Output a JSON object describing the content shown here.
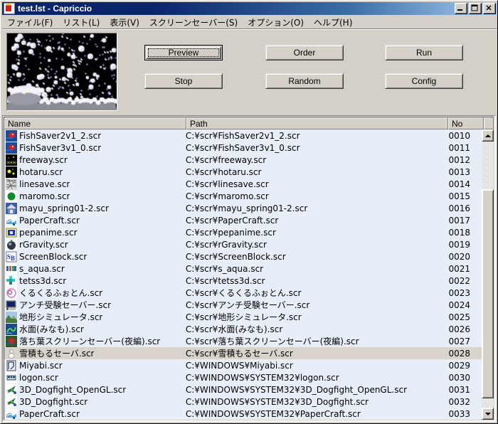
{
  "window": {
    "title": "test.lst - Capriccio",
    "icon": "app-icon",
    "controls": [
      {
        "name": "minimize-button",
        "glyph": "minimize"
      },
      {
        "name": "maximize-button",
        "glyph": "maximize"
      },
      {
        "name": "close-button",
        "glyph": "close"
      }
    ]
  },
  "menubar": {
    "items": [
      {
        "label": "ファイル(F)",
        "accel": "F"
      },
      {
        "label": "リスト(L)",
        "accel": "L"
      },
      {
        "label": "表示(V)",
        "accel": "V"
      },
      {
        "label": "スクリーンセーバー(S)",
        "accel": "S"
      },
      {
        "label": "オプション(O)",
        "accel": "O"
      },
      {
        "label": "ヘルプ(H)",
        "accel": "H"
      }
    ]
  },
  "preview": {
    "name": "screensaver-preview",
    "description": "snow-screensaver-preview",
    "background": "#000000"
  },
  "buttons": [
    {
      "name": "preview-button",
      "label": "Preview",
      "default": true,
      "focused": true
    },
    {
      "name": "order-button",
      "label": "Order",
      "default": false,
      "focused": false
    },
    {
      "name": "run-button",
      "label": "Run",
      "default": false,
      "focused": false
    },
    {
      "name": "stop-button",
      "label": "Stop",
      "default": false,
      "focused": false
    },
    {
      "name": "random-button",
      "label": "Random",
      "default": false,
      "focused": false
    },
    {
      "name": "config-button",
      "label": "Config",
      "default": false,
      "focused": false
    }
  ],
  "list": {
    "columns": [
      {
        "key": "name",
        "label": "Name"
      },
      {
        "key": "path",
        "label": "Path"
      },
      {
        "key": "no",
        "label": "No"
      }
    ],
    "row_background": "#e8eef8",
    "selected_background": "#d8d4cc",
    "rows": [
      {
        "name": "FishSaver2v1_2.scr",
        "path": "C:¥scr¥FishSaver2v1_2.scr",
        "no": "0010",
        "icon": "fish-icon",
        "selected": false
      },
      {
        "name": "FishSaver3v1_0.scr",
        "path": "C:¥scr¥FishSaver3v1_0.scr",
        "no": "0011",
        "icon": "fish-icon",
        "selected": false
      },
      {
        "name": "freeway.scr",
        "path": "C:¥scr¥freeway.scr",
        "no": "0012",
        "icon": "freeway-icon",
        "selected": false
      },
      {
        "name": "hotaru.scr",
        "path": "C:¥scr¥hotaru.scr",
        "no": "0013",
        "icon": "firefly-icon",
        "selected": false
      },
      {
        "name": "linesave.scr",
        "path": "C:¥scr¥linesave.scr",
        "no": "0014",
        "icon": "lines-icon",
        "selected": false
      },
      {
        "name": "maromo.scr",
        "path": "C:¥scr¥maromo.scr",
        "no": "0015",
        "icon": "green-circle-icon",
        "selected": false
      },
      {
        "name": "mayu_spring01-2.scr",
        "path": "C:¥scr¥mayu_spring01-2.scr",
        "no": "0016",
        "icon": "house-icon",
        "selected": false
      },
      {
        "name": "PaperCraft.scr",
        "path": "C:¥scr¥PaperCraft.scr",
        "no": "0017",
        "icon": "papercraft-icon",
        "selected": false
      },
      {
        "name": "pepanime.scr",
        "path": "C:¥scr¥pepanime.scr",
        "no": "0018",
        "icon": "pepanime-icon",
        "selected": false
      },
      {
        "name": "rGravity.scr",
        "path": "C:¥scr¥rGravity.scr",
        "no": "0019",
        "icon": "sphere-icon",
        "selected": false
      },
      {
        "name": "ScreenBlock.scr",
        "path": "C:¥scr¥ScreenBlock.scr",
        "no": "0020",
        "icon": "screenblock-icon",
        "selected": false
      },
      {
        "name": "s_aqua.scr",
        "path": "C:¥scr¥s_aqua.scr",
        "no": "0021",
        "icon": "aqua-icon",
        "selected": false
      },
      {
        "name": "tetss3d.scr",
        "path": "C:¥scr¥tetss3d.scr",
        "no": "0022",
        "icon": "tetris-icon",
        "selected": false
      },
      {
        "name": "くるくるふぉとん.scr",
        "path": "C:¥scr¥くるくるふぉとん.scr",
        "no": "0023",
        "icon": "spiral-icon",
        "selected": false
      },
      {
        "name": "アンチ受験セーバー.scr",
        "path": "C:¥scr¥アンチ受験セーバー.scr",
        "no": "0024",
        "icon": "monitor-icon",
        "selected": false
      },
      {
        "name": "地形シミュレータ.scr",
        "path": "C:¥scr¥地形シミュレータ.scr",
        "no": "0025",
        "icon": "terrain-icon",
        "selected": false
      },
      {
        "name": "水面(みなも).scr",
        "path": "C:¥scr¥水面(みなも).scr",
        "no": "0026",
        "icon": "water-icon",
        "selected": false
      },
      {
        "name": "落ち葉スクリーンセーバー(夜編).scr",
        "path": "C:¥scr¥落ち葉スクリーンセーバー(夜編).scr",
        "no": "0027",
        "icon": "leaf-icon",
        "selected": false
      },
      {
        "name": "雪積もるセーバ.scr",
        "path": "C:¥scr¥雪積もるセーバ.scr",
        "no": "0028",
        "icon": "snow-icon",
        "selected": true
      },
      {
        "name": "Miyabi.scr",
        "path": "C:¥WINDOWS¥Miyabi.scr",
        "no": "0029",
        "icon": "miyabi-icon",
        "selected": false
      },
      {
        "name": "logon.scr",
        "path": "C:¥WINDOWS¥SYSTEM32¥logon.scr",
        "no": "0030",
        "icon": "logon-icon",
        "selected": false
      },
      {
        "name": "3D_Dogfight_OpenGL.scr",
        "path": "C:¥WINDOWS¥SYSTEM32¥3D_Dogfight_OpenGL.scr",
        "no": "0031",
        "icon": "plane-icon",
        "selected": false
      },
      {
        "name": "3D_Dogfight.scr",
        "path": "C:¥WINDOWS¥SYSTEM32¥3D_Dogfight.scr",
        "no": "0032",
        "icon": "plane-icon",
        "selected": false
      },
      {
        "name": "PaperCraft.scr",
        "path": "C:¥WINDOWS¥SYSTEM32¥PaperCraft.scr",
        "no": "0033",
        "icon": "papercraft-icon",
        "selected": false
      }
    ]
  },
  "scrollbar": {
    "name": "list-vertical-scrollbar",
    "up_arrow": "scroll-up-arrow",
    "down_arrow": "scroll-down-arrow"
  }
}
